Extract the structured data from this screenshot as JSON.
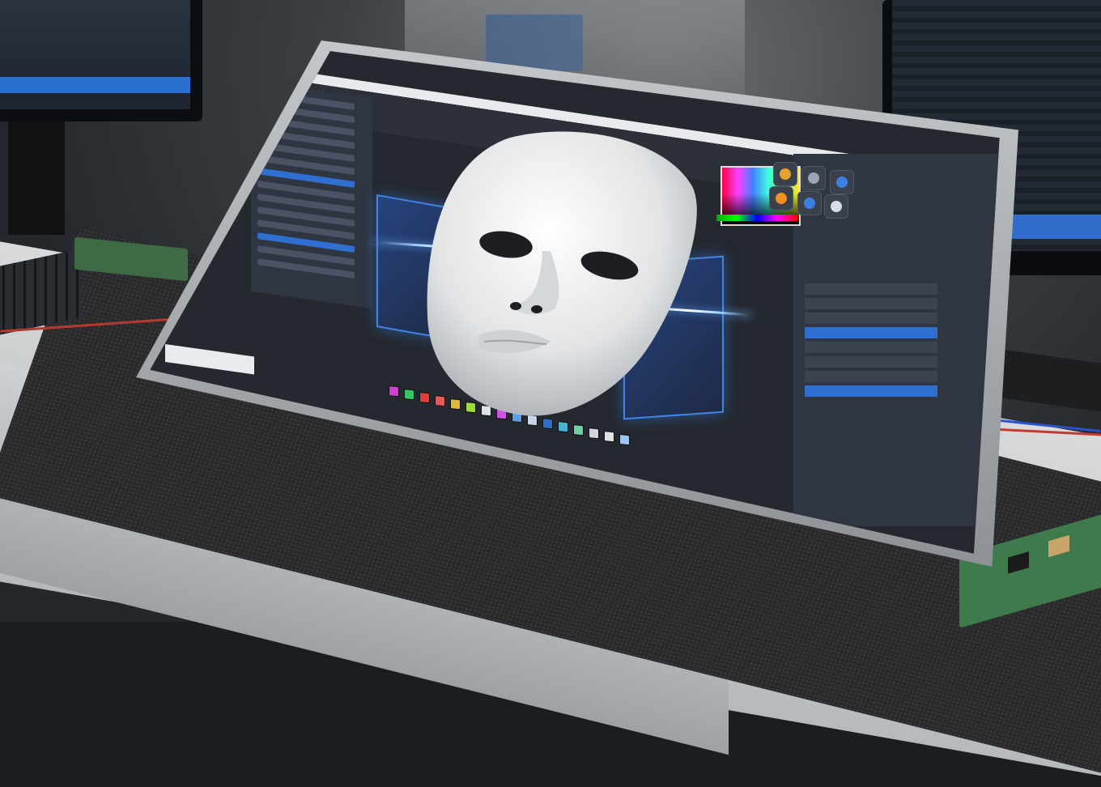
{
  "scene": {
    "description_tag": "tablet-3d-sculpt-app",
    "colors": {
      "accent": "#2f6fd0",
      "panel_dark": "#24282f",
      "panel_mid": "#303641",
      "glow": "#3f86e8",
      "mask": "#e6e8ea"
    }
  },
  "app": {
    "menu_items": [
      "",
      "",
      "",
      "",
      "",
      "",
      "",
      "",
      "",
      ""
    ],
    "left_panel_rows": 14,
    "left_panel_selected": [
      6,
      11
    ],
    "right_panel_rows": [
      {
        "selected": false
      },
      {
        "selected": false
      },
      {
        "selected": false
      },
      {
        "selected": true
      },
      {
        "selected": false
      },
      {
        "selected": false
      },
      {
        "selected": false
      },
      {
        "selected": true
      }
    ],
    "swatch_colors": [
      "#d33fd3",
      "#37c46a",
      "#e33b3b",
      "#e35a5a",
      "#e0b93a",
      "#9fd83a",
      "#dfe3e8",
      "#cf56e0",
      "#5aa0e8",
      "#c9d5e6",
      "#2d6dc6",
      "#48b4cf",
      "#6ecfa1",
      "#cfd6e0",
      "#dfe3e8",
      "#9cc6f0"
    ],
    "tool_icons": [
      {
        "name": "paint-brush-icon",
        "color": "#e5a233"
      },
      {
        "name": "move-icon",
        "color": "#9aa6b5"
      },
      {
        "name": "sculpt-icon",
        "color": "#3b7fe0"
      },
      {
        "name": "material-orange-icon",
        "color": "#f09020"
      },
      {
        "name": "material-blue-icon",
        "color": "#3a80e0"
      },
      {
        "name": "gear-icon",
        "color": "#d8dde5"
      }
    ]
  }
}
